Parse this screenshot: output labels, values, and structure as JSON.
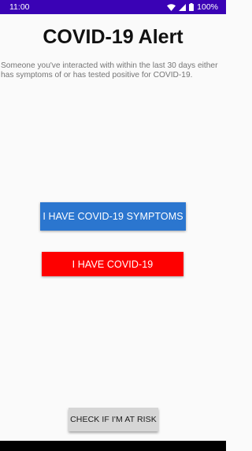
{
  "status_bar": {
    "time": "11:00",
    "battery": "100%",
    "icons": [
      "wifi-icon",
      "cell-signal-icon",
      "battery-icon"
    ],
    "background": "#3a02b5"
  },
  "title": "COVID-19 Alert",
  "message": "Someone you've interacted with within the last 30 days either has symptoms of or has tested positive for COVID-19.",
  "buttons": {
    "symptoms": {
      "label": "I HAVE COVID-19 SYMPTOMS",
      "color": "#2b76cf"
    },
    "covid": {
      "label": "I HAVE COVID-19",
      "color": "#fe0000"
    },
    "risk": {
      "label": "CHECK IF I'M AT RISK",
      "color": "#d6d6d6"
    }
  }
}
